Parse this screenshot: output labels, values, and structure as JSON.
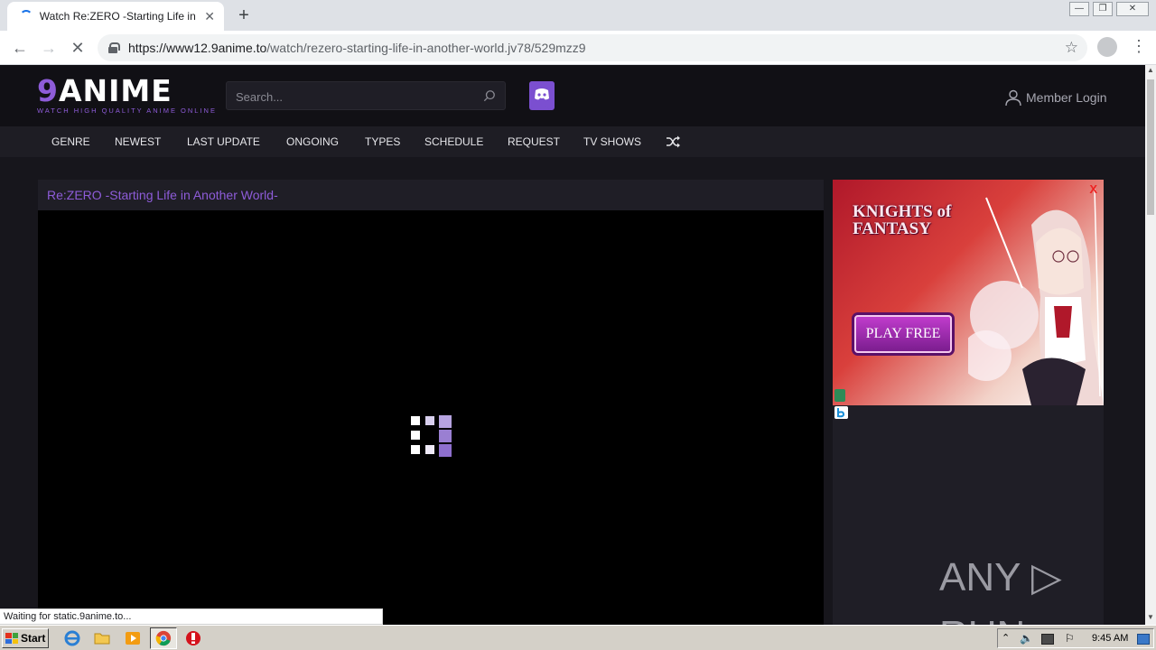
{
  "browser": {
    "tab_title": "Watch Re:ZERO -Starting Life in Another World-",
    "tab_close": "✕",
    "new_tab": "+",
    "url_host": "https://www12.9anime.to",
    "url_path": "/watch/rezero-starting-life-in-another-world.jv78/529mzz9",
    "back": "←",
    "forward": "→",
    "reload": "✕",
    "bookmark": "☆",
    "menu": "⋮",
    "win_minimize": "—",
    "win_restore": "❐",
    "win_close": "✕",
    "status_text": "Waiting for static.9anime.to..."
  },
  "site": {
    "logo_nine": "9",
    "logo_word": "ANIME",
    "logo_tagline": "WATCH HIGH QUALITY ANIME ONLINE",
    "search_placeholder": "Search...",
    "login_label": "Member Login",
    "nav": [
      "GENRE",
      "NEWEST",
      "LAST UPDATE",
      "ONGOING",
      "TYPES",
      "SCHEDULE",
      "REQUEST",
      "TV SHOWS"
    ],
    "accent_color": "#8e5cd9"
  },
  "player": {
    "title": "Re:ZERO -Starting Life in Another World-"
  },
  "ad": {
    "close_label": "X",
    "game_title_line1": "KNIGHTS of",
    "game_title_line2": "FANTASY",
    "cta_label": "PLAY FREE"
  },
  "watermark": {
    "text": "ANY ▷ RUN"
  },
  "taskbar": {
    "start_label": "Start",
    "clock": "9:45 AM"
  }
}
